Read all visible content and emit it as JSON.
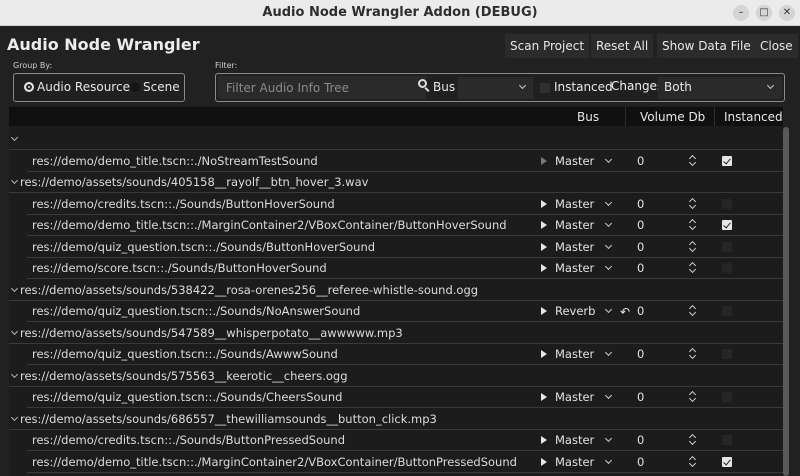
{
  "window": {
    "title": "Audio Node Wrangler Addon (DEBUG)",
    "minimize_icon": "minimize-icon",
    "maximize_icon": "maximize-icon",
    "close_icon": "close-icon"
  },
  "app": {
    "title": "Audio Node Wrangler",
    "buttons": {
      "scan": "Scan Project",
      "reset": "Reset All",
      "show_data": "Show Data File",
      "close": "Close"
    }
  },
  "group_by": {
    "label": "Group By:",
    "options": [
      {
        "label": "Audio Resource",
        "selected": true
      },
      {
        "label": "Scene",
        "selected": false
      }
    ]
  },
  "filter": {
    "label": "Filter:",
    "placeholder": "Filter Audio Info Tree",
    "value": "",
    "bus_label": "Bus",
    "bus_value": "",
    "instanced_label": "Instanced",
    "changes_label": "Changes",
    "changes_value": "Both"
  },
  "columns": {
    "bus": "Bus",
    "volume": "Volume Db",
    "instanced": "Instanced?"
  },
  "rows": [
    {
      "type": "group",
      "name": ""
    },
    {
      "type": "item",
      "name": "res://demo/demo_title.tscn::./NoStreamTestSound",
      "bus": "Master",
      "volume": "0",
      "instanced": true,
      "playable": false,
      "undo": false
    },
    {
      "type": "group",
      "name": "res://demo/assets/sounds/405158__rayolf__btn_hover_3.wav"
    },
    {
      "type": "item",
      "name": "res://demo/credits.tscn::./Sounds/ButtonHoverSound",
      "bus": "Master",
      "volume": "0",
      "instanced": false,
      "playable": true,
      "undo": false
    },
    {
      "type": "item",
      "name": "res://demo/demo_title.tscn::./MarginContainer2/VBoxContainer/ButtonHoverSound",
      "bus": "Master",
      "volume": "0",
      "instanced": true,
      "playable": true,
      "undo": false
    },
    {
      "type": "item",
      "name": "res://demo/quiz_question.tscn::./Sounds/ButtonHoverSound",
      "bus": "Master",
      "volume": "0",
      "instanced": false,
      "playable": true,
      "undo": false
    },
    {
      "type": "item",
      "name": "res://demo/score.tscn::./Sounds/ButtonHoverSound",
      "bus": "Master",
      "volume": "0",
      "instanced": false,
      "playable": true,
      "undo": false
    },
    {
      "type": "group",
      "name": "res://demo/assets/sounds/538422__rosa-orenes256__referee-whistle-sound.ogg"
    },
    {
      "type": "item",
      "name": "res://demo/quiz_question.tscn::./Sounds/NoAnswerSound",
      "bus": "Reverb",
      "volume": "0",
      "instanced": false,
      "playable": true,
      "undo": true
    },
    {
      "type": "group",
      "name": "res://demo/assets/sounds/547589__whisperpotato__awwwww.mp3"
    },
    {
      "type": "item",
      "name": "res://demo/quiz_question.tscn::./Sounds/AwwwSound",
      "bus": "Master",
      "volume": "0",
      "instanced": false,
      "playable": true,
      "undo": false
    },
    {
      "type": "group",
      "name": "res://demo/assets/sounds/575563__keerotic__cheers.ogg"
    },
    {
      "type": "item",
      "name": "res://demo/quiz_question.tscn::./Sounds/CheersSound",
      "bus": "Master",
      "volume": "0",
      "instanced": false,
      "playable": true,
      "undo": false
    },
    {
      "type": "group",
      "name": "res://demo/assets/sounds/686557__thewilliamsounds__button_click.mp3"
    },
    {
      "type": "item",
      "name": "res://demo/credits.tscn::./Sounds/ButtonPressedSound",
      "bus": "Master",
      "volume": "0",
      "instanced": false,
      "playable": true,
      "undo": false
    },
    {
      "type": "item",
      "name": "res://demo/demo_title.tscn::./MarginContainer2/VBoxContainer/ButtonPressedSound",
      "bus": "Master",
      "volume": "0",
      "instanced": true,
      "playable": true,
      "undo": false
    }
  ]
}
